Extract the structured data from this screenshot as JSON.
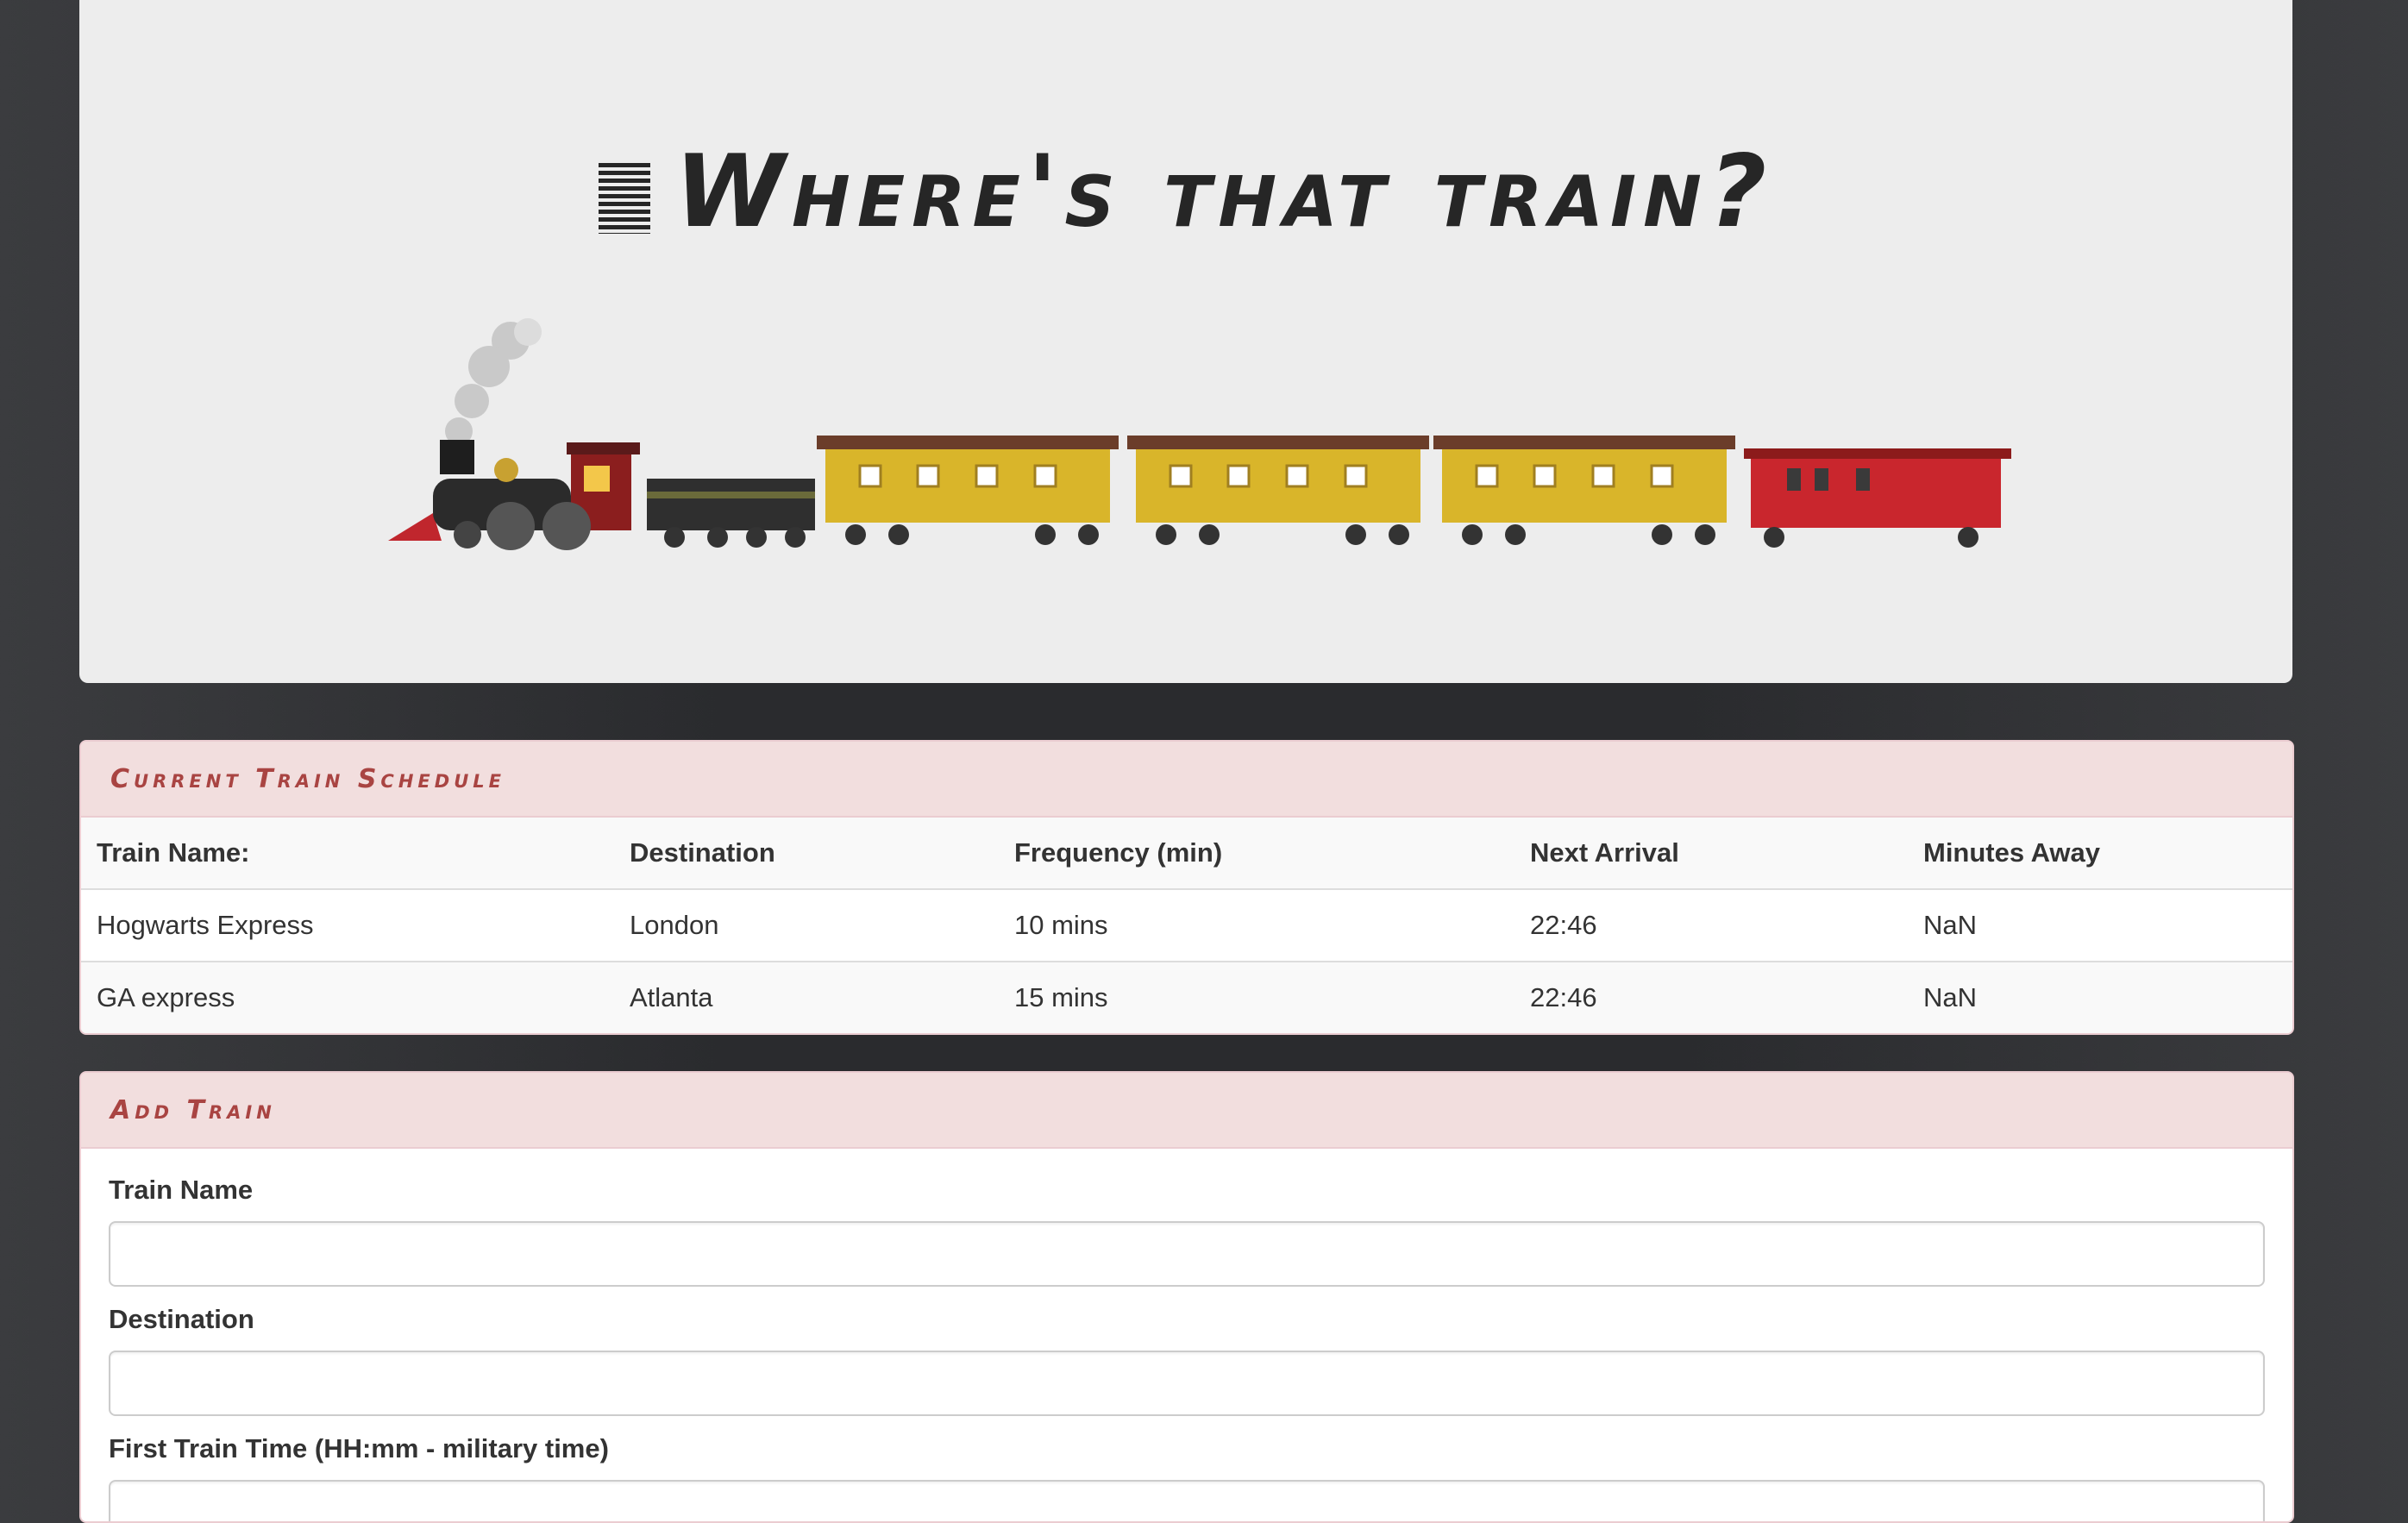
{
  "header": {
    "title": "Where's that train?"
  },
  "schedule": {
    "heading": "Current Train Schedule",
    "columns": [
      "Train Name:",
      "Destination",
      "Frequency (min)",
      "Next Arrival",
      "Minutes Away"
    ],
    "rows": [
      [
        "Hogwarts Express",
        "London",
        "10 mins",
        "22:46",
        "NaN"
      ],
      [
        "GA express",
        "Atlanta",
        "15 mins",
        "22:46",
        "NaN"
      ]
    ]
  },
  "add_train": {
    "heading": "Add Train",
    "fields": [
      {
        "label": "Train Name",
        "value": ""
      },
      {
        "label": "Destination",
        "value": ""
      },
      {
        "label": "First Train Time (HH:mm - military time)",
        "value": ""
      }
    ]
  },
  "colors": {
    "panel_heading": "#a94442",
    "panel_bg": "#f2dede",
    "page_bg": "#2a2b2e"
  }
}
